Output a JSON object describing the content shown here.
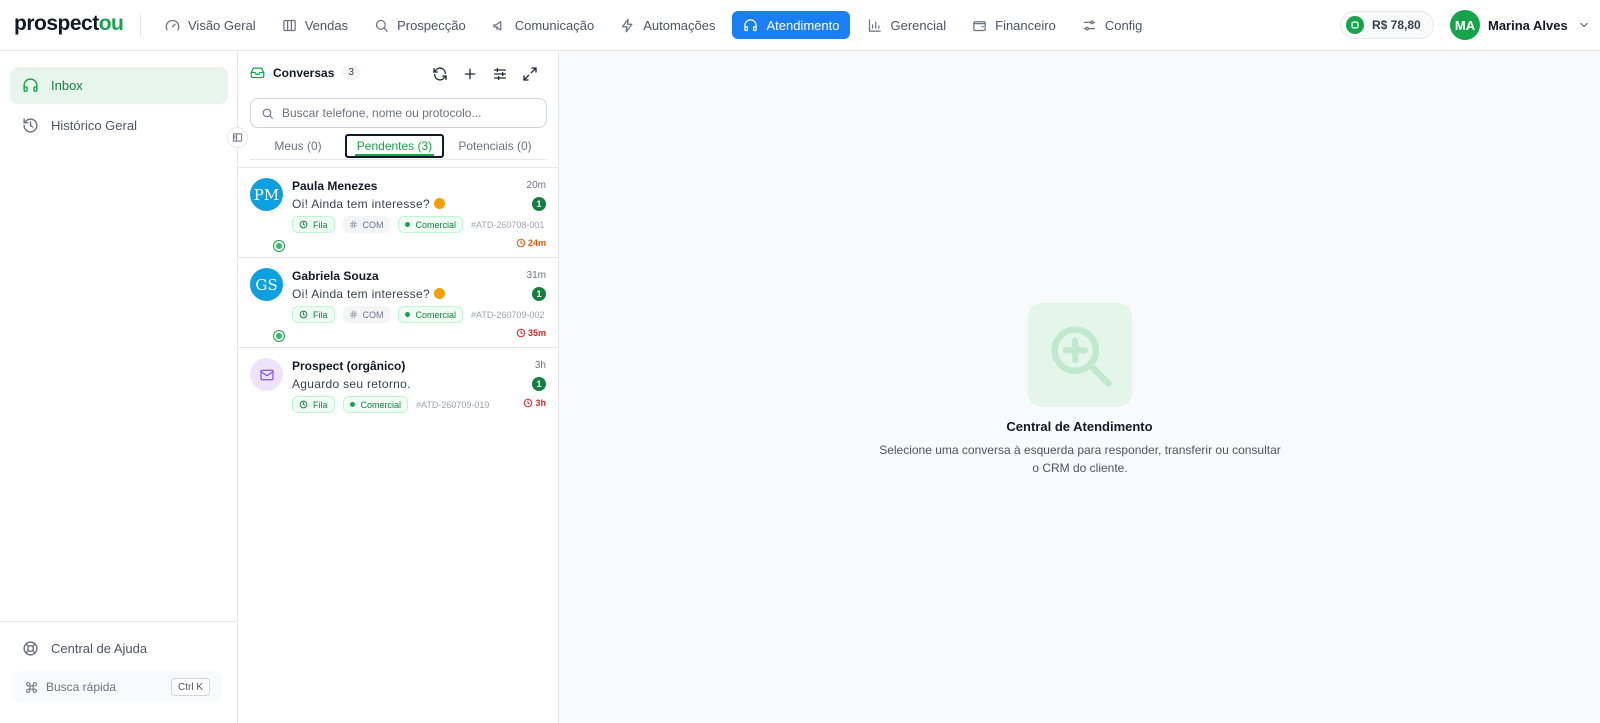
{
  "app": {
    "logo_main": "prospect",
    "logo_accent": "ou"
  },
  "nav": [
    {
      "label": "Visão Geral",
      "icon": "gauge-icon"
    },
    {
      "label": "Vendas",
      "icon": "store-icon"
    },
    {
      "label": "Prospecção",
      "icon": "search-icon"
    },
    {
      "label": "Comunicação",
      "icon": "megaphone-icon"
    },
    {
      "label": "Automações",
      "icon": "zap-icon"
    },
    {
      "label": "Atendimento",
      "icon": "headset-icon",
      "active": true
    },
    {
      "label": "Gerencial",
      "icon": "bar-chart-icon"
    },
    {
      "label": "Financeiro",
      "icon": "wallet-icon"
    },
    {
      "label": "Config",
      "icon": "sliders-icon"
    }
  ],
  "balance": "R$ 78,80",
  "user": {
    "initials": "MA",
    "name": "Marina Alves"
  },
  "sidebar": {
    "items": [
      {
        "label": "Inbox",
        "icon": "headset-icon",
        "active": true
      },
      {
        "label": "Histórico Geral",
        "icon": "history-icon"
      }
    ],
    "help": "Central de Ajuda",
    "quick_search": "Busca rápida",
    "quick_search_kbd": "Ctrl K"
  },
  "conversations": {
    "title": "Conversas",
    "count": "3",
    "search_placeholder": "Buscar telefone, nome ou protocolo...",
    "tabs": [
      {
        "label": "Meus (0)"
      },
      {
        "label": "Pendentes (3)",
        "active": true
      },
      {
        "label": "Potenciais (0)"
      }
    ],
    "items": [
      {
        "initials": "PM",
        "name": "Paula Menezes",
        "time": "20m",
        "message": "Oi! Ainda tem interesse?",
        "unread": "1",
        "tag_fila": "Fila",
        "tag_dept": "COM",
        "tag_comercial": "Comercial",
        "protocol": "#ATD-260708-001",
        "sla": "24m"
      },
      {
        "initials": "GS",
        "name": "Gabriela Souza",
        "time": "31m",
        "message": "Oi! Ainda tem interesse?",
        "unread": "1",
        "tag_fila": "Fila",
        "tag_dept": "COM",
        "tag_comercial": "Comercial",
        "protocol": "#ATD-260709-002",
        "sla": "35m"
      },
      {
        "name": "Prospect (orgânico)",
        "time": "3h",
        "message": "Aguardo seu retorno.",
        "unread": "1",
        "tag_fila": "Fila",
        "tag_comercial": "Comercial",
        "protocol": "#ATD-260709-019",
        "sla": "3h"
      }
    ]
  },
  "empty_state": {
    "title": "Central de Atendimento",
    "description": "Selecione uma conversa à esquerda para responder, transferir ou consultar o CRM do cliente."
  },
  "colors": {
    "brand": "#16a34a",
    "active_nav": "#1a7ef5",
    "sla_warning": "#ea580c",
    "sla_overdue": "#dc2626"
  }
}
